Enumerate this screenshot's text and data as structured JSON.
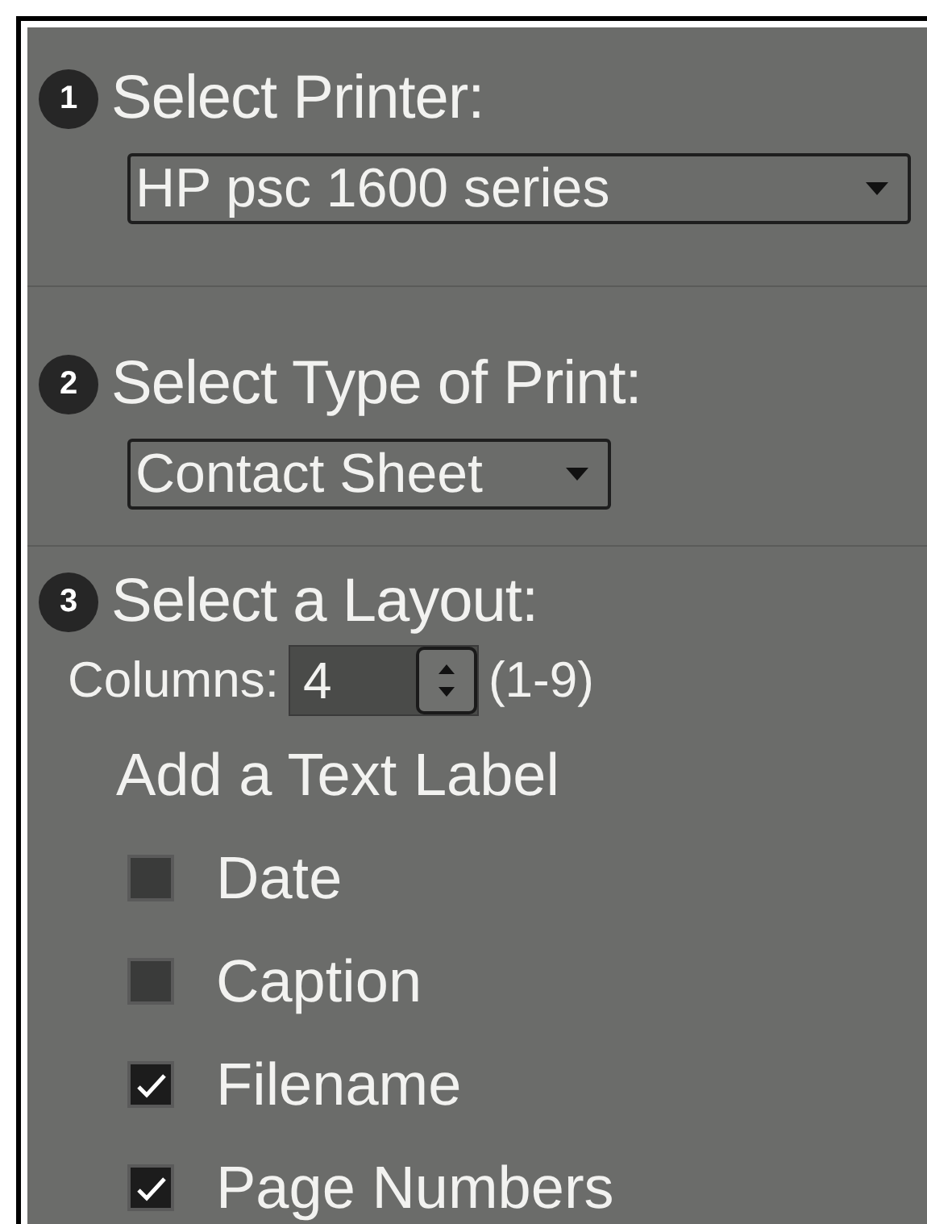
{
  "steps": [
    {
      "number": "1",
      "title": "Select Printer:",
      "kind": "select",
      "select": {
        "value": "HP psc 1600 series",
        "wide": true
      }
    },
    {
      "number": "2",
      "title": "Select Type of Print:",
      "kind": "select",
      "select": {
        "value": "Contact Sheet",
        "wide": false
      }
    },
    {
      "number": "3",
      "title": "Select a Layout:",
      "kind": "layout",
      "columns": {
        "label": "Columns:",
        "value": "4",
        "range": "(1-9)"
      },
      "text_label": {
        "heading": "Add a Text Label",
        "options": [
          {
            "label": "Date",
            "checked": false
          },
          {
            "label": "Caption",
            "checked": false
          },
          {
            "label": "Filename",
            "checked": true
          },
          {
            "label": "Page Numbers",
            "checked": true
          }
        ]
      }
    }
  ]
}
